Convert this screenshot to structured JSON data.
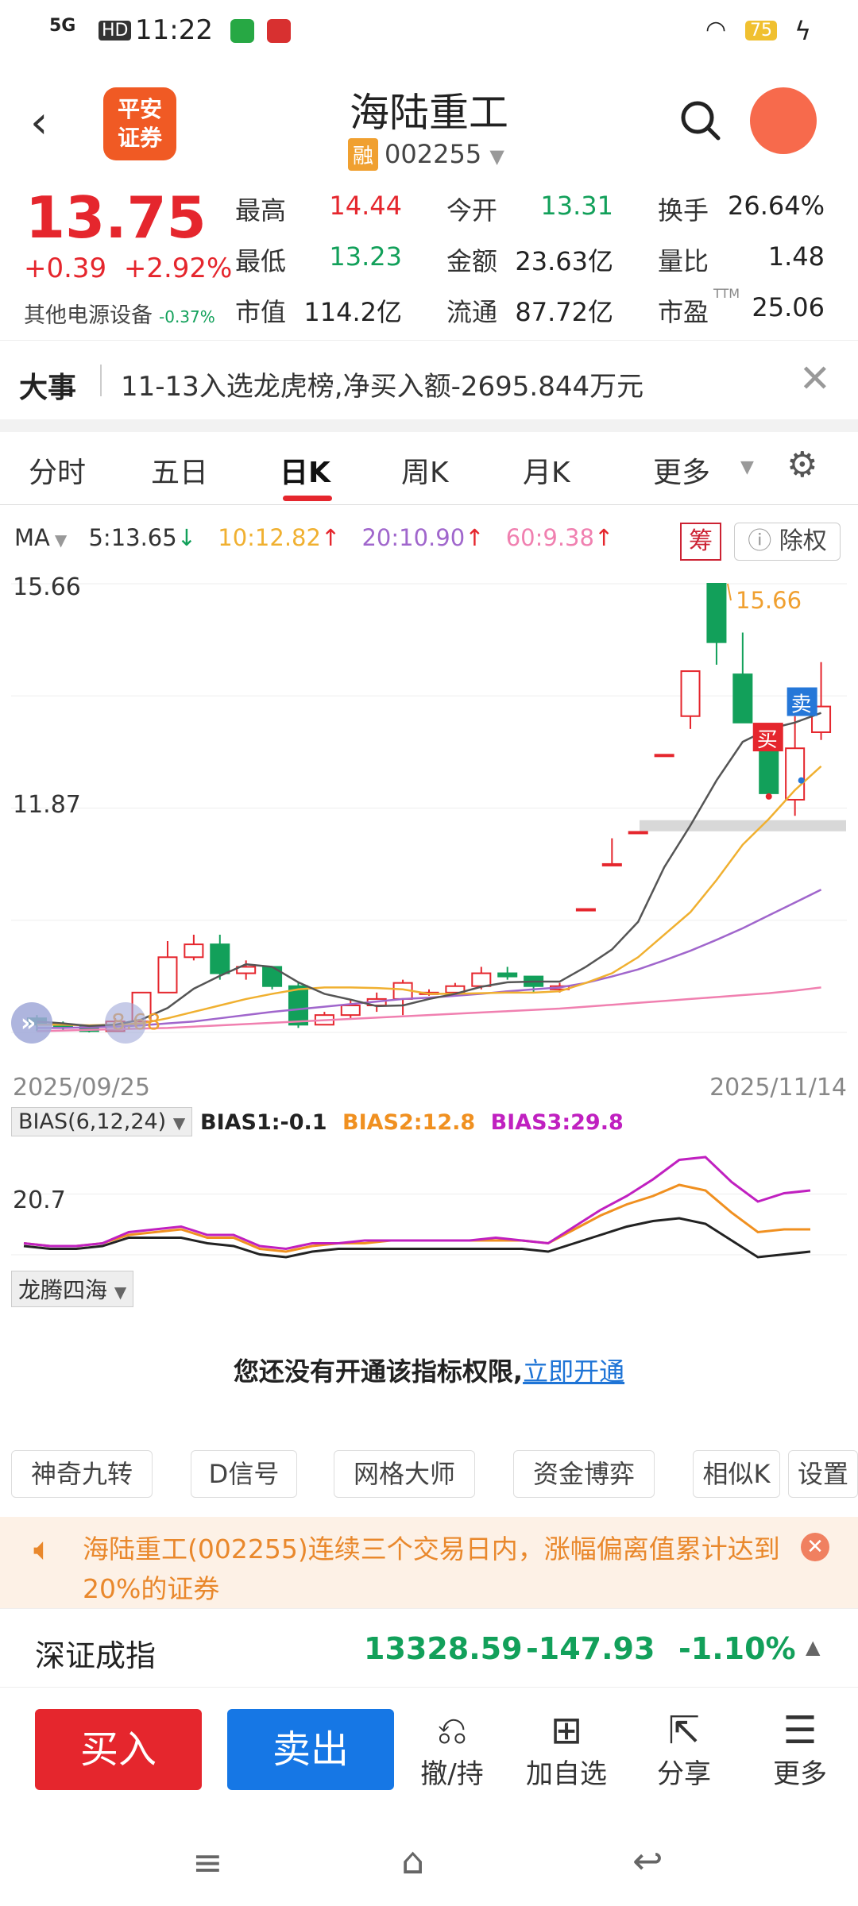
{
  "status_bar": {
    "time": "11:22",
    "network": "5G",
    "hd": "HD",
    "battery": "75"
  },
  "header": {
    "logo_line1": "平安",
    "logo_line2": "证券",
    "title": "海陆重工",
    "rong": "融",
    "code": "002255"
  },
  "quote": {
    "price": "13.75",
    "change": "+0.39",
    "change_pct": "+2.92%",
    "sector": "其他电源设备",
    "sector_pct": "-0.37%",
    "rows": [
      [
        {
          "label": "最高",
          "value": "14.44",
          "color": "red"
        },
        {
          "label": "今开",
          "value": "13.31",
          "color": "green"
        },
        {
          "label": "换手",
          "value": "26.64%",
          "color": "dark"
        }
      ],
      [
        {
          "label": "最低",
          "value": "13.23",
          "color": "green"
        },
        {
          "label": "金额",
          "value": "23.63亿",
          "color": "dark"
        },
        {
          "label": "量比",
          "value": "1.48",
          "color": "dark"
        }
      ],
      [
        {
          "label": "市值",
          "value": "114.2亿",
          "color": "dark"
        },
        {
          "label": "流通",
          "value": "87.72亿",
          "color": "dark"
        },
        {
          "label": "市盈",
          "value": "25.06",
          "color": "dark",
          "sup": "TTM"
        }
      ]
    ]
  },
  "news": {
    "tag": "大事",
    "text": "11-13入选龙虎榜,净买入额-2695.844万元"
  },
  "tabs": [
    "分时",
    "五日",
    "日K",
    "周K",
    "月K",
    "更多"
  ],
  "active_tab": "日K",
  "ma_legend": {
    "ma": "MA",
    "ma5": "5:13.65",
    "ma10": "10:12.82",
    "ma20": "20:10.90",
    "ma60": "60:9.38"
  },
  "chart_buttons": {
    "chou": "筹",
    "chuquan": "除权"
  },
  "markers": {
    "buy": "买",
    "sell": "卖",
    "high_label": "15.66",
    "low_label": "8.68"
  },
  "chart_data": {
    "type": "candlestick",
    "y_ticks": [
      "15.66",
      "11.87",
      "8.68"
    ],
    "x_start": "2025/09/25",
    "x_end": "2025/11/14",
    "ohlc": [
      [
        8.9,
        8.95,
        8.7,
        8.8
      ],
      [
        8.8,
        8.85,
        8.7,
        8.78
      ],
      [
        8.78,
        8.8,
        8.68,
        8.7
      ],
      [
        8.7,
        8.9,
        8.7,
        8.85
      ],
      [
        8.85,
        9.3,
        8.85,
        9.3
      ],
      [
        9.3,
        10.1,
        9.3,
        9.85
      ],
      [
        9.85,
        10.2,
        9.8,
        10.05
      ],
      [
        10.05,
        10.2,
        9.5,
        9.6
      ],
      [
        9.6,
        9.8,
        9.5,
        9.7
      ],
      [
        9.7,
        9.7,
        9.35,
        9.4
      ],
      [
        9.4,
        9.45,
        8.75,
        8.8
      ],
      [
        8.8,
        9.0,
        8.8,
        8.95
      ],
      [
        8.95,
        9.2,
        8.9,
        9.1
      ],
      [
        9.1,
        9.3,
        9.0,
        9.2
      ],
      [
        9.2,
        9.5,
        8.95,
        9.45
      ],
      [
        9.3,
        9.35,
        9.25,
        9.3
      ],
      [
        9.3,
        9.45,
        9.3,
        9.4
      ],
      [
        9.4,
        9.7,
        9.35,
        9.6
      ],
      [
        9.6,
        9.7,
        9.5,
        9.55
      ],
      [
        9.55,
        9.55,
        9.3,
        9.4
      ],
      [
        9.35,
        9.45,
        9.3,
        9.4
      ],
      [
        10.6,
        10.6,
        10.6,
        10.6
      ],
      [
        11.3,
        11.7,
        11.3,
        11.3
      ],
      [
        11.8,
        11.8,
        11.8,
        11.8
      ],
      [
        13.0,
        13.0,
        13.0,
        13.0
      ],
      [
        13.6,
        14.3,
        13.4,
        14.3
      ],
      [
        15.66,
        15.66,
        14.4,
        14.75
      ],
      [
        14.25,
        14.9,
        13.5,
        13.5
      ],
      [
        13.13,
        13.4,
        12.4,
        12.4
      ],
      [
        12.3,
        13.6,
        12.05,
        13.1
      ],
      [
        13.35,
        14.44,
        13.23,
        13.75
      ]
    ],
    "ma5": [
      8.85,
      8.82,
      8.78,
      8.8,
      8.88,
      9.06,
      9.36,
      9.56,
      9.74,
      9.7,
      9.46,
      9.28,
      9.19,
      9.09,
      9.1,
      9.2,
      9.28,
      9.39,
      9.46,
      9.47,
      9.47,
      9.7,
      9.97,
      10.4,
      11.25,
      11.9,
      12.6,
      13.2,
      13.4,
      13.5,
      13.65
    ],
    "ma10": [
      8.8,
      8.8,
      8.79,
      8.8,
      8.82,
      8.9,
      9.0,
      9.1,
      9.2,
      9.28,
      9.35,
      9.38,
      9.38,
      9.37,
      9.35,
      9.28,
      9.28,
      9.29,
      9.3,
      9.3,
      9.32,
      9.45,
      9.6,
      9.85,
      10.2,
      10.55,
      11.05,
      11.6,
      12.0,
      12.45,
      12.82
    ],
    "ma20": [
      8.75,
      8.75,
      8.76,
      8.77,
      8.79,
      8.82,
      8.85,
      8.9,
      8.95,
      9.0,
      9.04,
      9.08,
      9.12,
      9.16,
      9.2,
      9.22,
      9.25,
      9.28,
      9.32,
      9.35,
      9.38,
      9.45,
      9.55,
      9.66,
      9.8,
      9.95,
      10.12,
      10.3,
      10.5,
      10.7,
      10.9
    ],
    "ma60": [
      8.7,
      8.71,
      8.72,
      8.73,
      8.74,
      8.75,
      8.77,
      8.79,
      8.81,
      8.83,
      8.85,
      8.87,
      8.89,
      8.91,
      8.93,
      8.95,
      8.97,
      8.99,
      9.01,
      9.03,
      9.05,
      9.08,
      9.11,
      9.14,
      9.17,
      9.2,
      9.23,
      9.26,
      9.29,
      9.33,
      9.38
    ],
    "ylim": [
      8.68,
      15.66
    ]
  },
  "bias": {
    "button": "BIAS(6,12,24)",
    "bias1": "BIAS1:-0.1",
    "bias2": "BIAS2:12.8",
    "bias3": "BIAS3:29.8",
    "axis_label": "20.7",
    "series1": [
      2,
      1,
      1,
      2,
      5,
      5,
      5,
      3,
      2,
      -1,
      -2,
      0,
      1,
      1,
      1,
      1,
      1,
      1,
      1,
      1,
      0,
      3,
      6,
      9,
      11,
      12,
      10,
      4,
      -2,
      -1,
      0
    ],
    "series2": [
      3,
      2,
      2,
      3,
      6,
      7,
      8,
      5,
      5,
      1,
      0,
      2,
      3,
      3,
      4,
      4,
      4,
      4,
      4,
      4,
      3,
      8,
      13,
      17,
      20,
      24,
      22,
      14,
      7,
      8,
      8
    ],
    "series3": [
      3,
      2,
      2,
      3,
      7,
      8,
      9,
      6,
      6,
      2,
      1,
      3,
      3,
      4,
      4,
      4,
      4,
      4,
      5,
      4,
      3,
      9,
      15,
      20,
      26,
      33,
      34,
      25,
      18,
      21,
      22
    ],
    "ylim": [
      -4,
      36
    ]
  },
  "indicator": {
    "button": "龙腾四海",
    "notice": "您还没有开通该指标权限,",
    "link": "立即开通"
  },
  "tools": [
    "神奇九转",
    "D信号",
    "网格大师",
    "资金博弈",
    "相似K",
    "设置"
  ],
  "warning": {
    "text": "海陆重工(002255)连续三个交易日内，涨幅偏离值累计达到20%的证券"
  },
  "index": {
    "name": "深证成指",
    "value": "13328.59",
    "change": "-147.93",
    "pct": "-1.10%"
  },
  "bottom": {
    "buy": "买入",
    "sell": "卖出",
    "actions": [
      "撤/持",
      "加自选",
      "分享",
      "更多"
    ]
  },
  "colors": {
    "up": "#e5262d",
    "down": "#12a05a",
    "ma5": "#555555",
    "ma10": "#f0b030",
    "ma20": "#a066cc",
    "ma60": "#f080b0"
  }
}
